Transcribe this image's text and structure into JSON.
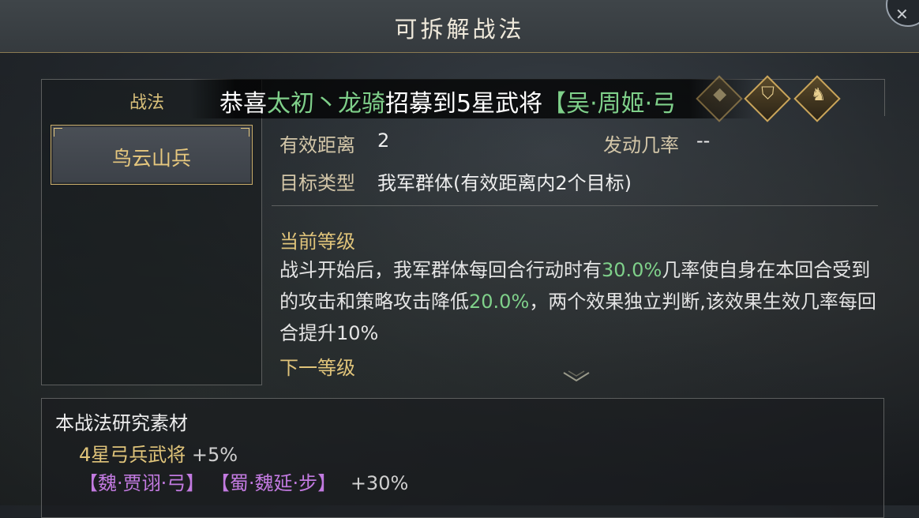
{
  "header": {
    "title": "可拆解战法"
  },
  "left_panel": {
    "label": "战法",
    "skills": [
      {
        "name": "鸟云山兵"
      }
    ]
  },
  "banner": {
    "prefix": "恭喜",
    "player_name": "太初丶龙骑",
    "middle": "招募到5星武将",
    "general": "【吴·周姬·弓"
  },
  "icons": [
    "shield-icon",
    "horse-head-icon",
    "diamond-icon"
  ],
  "info": {
    "range_label": "有效距离",
    "range_value": "2",
    "rate_label": "发动几率",
    "rate_value": "--",
    "target_label": "目标类型",
    "target_value": "我军群体(有效距离内2个目标)"
  },
  "current_level": {
    "heading": "当前等级",
    "desc_1": "战斗开始后，我军群体每回合行动时有",
    "desc_pct1": "30.0%",
    "desc_2": "几率使自身在本回合受到的攻击和策略攻击降低",
    "desc_pct2": "20.0%",
    "desc_3": "，两个效果独立判断,该效果生效几率每回合提升10%"
  },
  "next_level": {
    "heading": "下一等级"
  },
  "materials": {
    "title": "本战法研究素材",
    "line1_name": "4星弓兵武将",
    "line1_bonus": "+5%",
    "line2_hero1": "【魏·贾诩·弓】",
    "line2_hero2": "【蜀·魏延·步】",
    "line2_bonus": "+30%"
  },
  "colors": {
    "gold": "#e0c47a",
    "green": "#7fd08a",
    "purple": "#c27ae0"
  }
}
